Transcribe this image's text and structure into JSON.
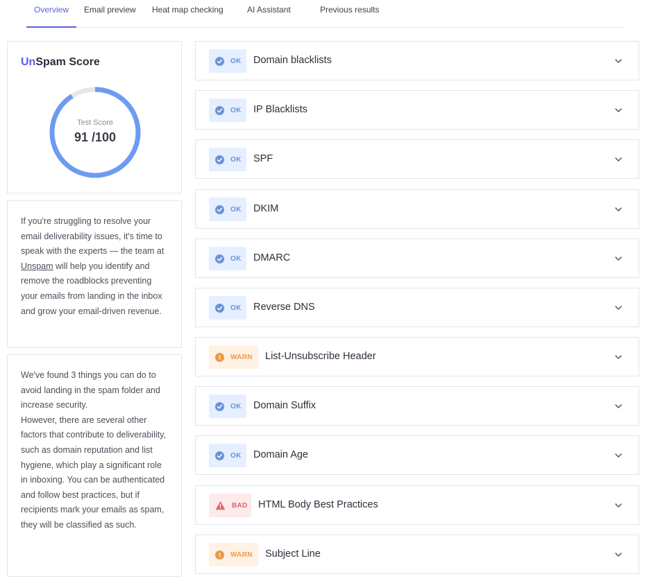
{
  "tabs": [
    {
      "label": "Overview",
      "active": true
    },
    {
      "label": "Email preview",
      "active": false
    },
    {
      "label": "Heat map checking",
      "active": false
    },
    {
      "label": "AI Assistant",
      "active": false
    },
    {
      "label": "Previous results",
      "active": false
    }
  ],
  "score": {
    "title_brand": "Un",
    "title_rest": "Spam Score",
    "label": "Test Score",
    "value_text": "91 /100",
    "value": 91,
    "max": 100,
    "ring_color": "#6d9bf2",
    "track_color": "#e6e7eb"
  },
  "info": {
    "text_before": "If you're struggling to resolve your email deliverability issues, it's time to speak with the experts — the team at ",
    "link": "Unspam",
    "text_after": " will help you identify and remove the roadblocks preventing your emails from landing in the inbox and grow your email-driven revenue."
  },
  "found": {
    "paragraph1": "We've found 3 things you can do to avoid landing in the spam folder and increase security.",
    "paragraph2": "However, there are several other factors that contribute to deliverability, such as domain reputation and list hygiene, which play a significant role in inboxing. You can be authenticated and follow best practices, but if recipients mark your emails as spam, they will be classified as such."
  },
  "checks": [
    {
      "status": "OK",
      "kind": "ok",
      "label": "Domain blacklists"
    },
    {
      "status": "OK",
      "kind": "ok",
      "label": "IP Blacklists"
    },
    {
      "status": "OK",
      "kind": "ok",
      "label": "SPF"
    },
    {
      "status": "OK",
      "kind": "ok",
      "label": "DKIM"
    },
    {
      "status": "OK",
      "kind": "ok",
      "label": "DMARC"
    },
    {
      "status": "OK",
      "kind": "ok",
      "label": "Reverse DNS"
    },
    {
      "status": "WARN",
      "kind": "warn",
      "label": "List-Unsubscribe Header"
    },
    {
      "status": "OK",
      "kind": "ok",
      "label": "Domain Suffix"
    },
    {
      "status": "OK",
      "kind": "ok",
      "label": "Domain Age"
    },
    {
      "status": "BAD",
      "kind": "bad",
      "label": "HTML Body Best Practices"
    },
    {
      "status": "WARN",
      "kind": "warn",
      "label": "Subject Line"
    }
  ],
  "colors": {
    "accent": "#5b5fe0",
    "ok": "#6a93d6",
    "warn": "#e99a46",
    "bad": "#e06565"
  },
  "icons": {
    "ok": "check-circle-icon",
    "warn": "exclamation-circle-icon",
    "bad": "warning-triangle-icon",
    "expand": "chevron-down-icon"
  }
}
